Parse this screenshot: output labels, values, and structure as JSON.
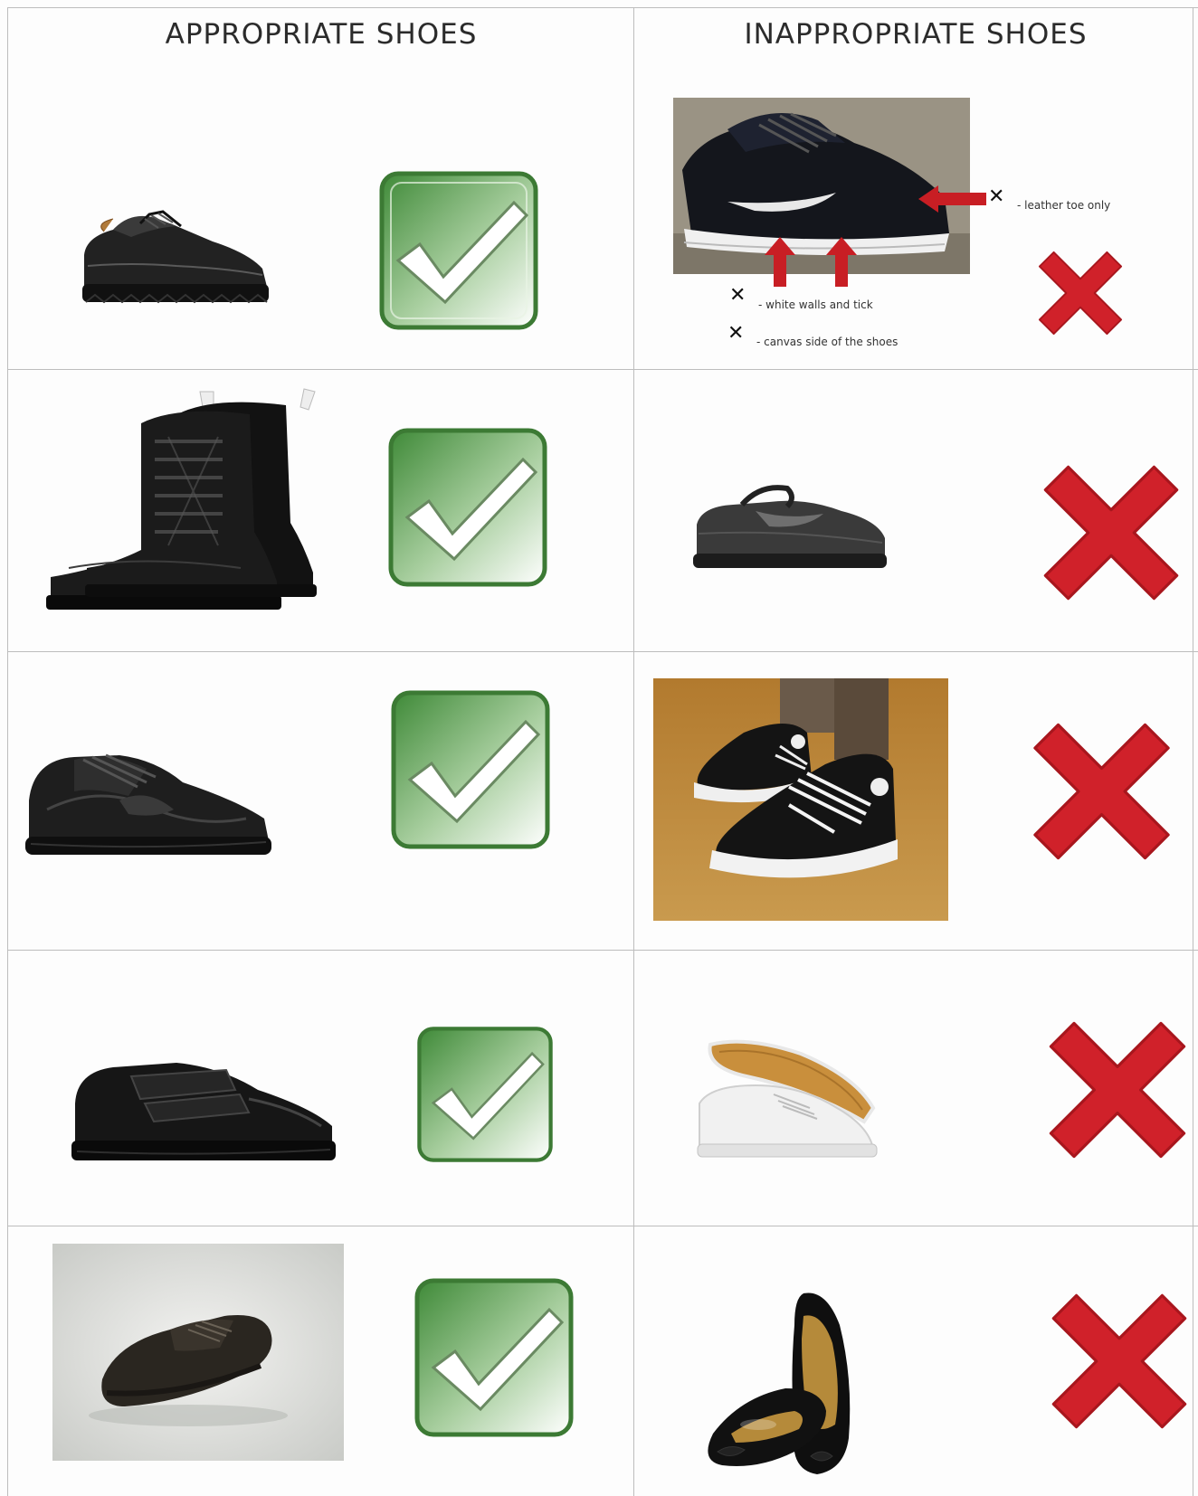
{
  "headers": {
    "appropriate": "APPROPRIATE SHOES",
    "inappropriate": "INAPPROPRIATE SHOES"
  },
  "annotations": {
    "leather_toe": "- leather toe only",
    "white_walls": "- white walls and tick",
    "canvas_side": "- canvas side of the shoes",
    "mark": "✕"
  },
  "appropriate_items": [
    "black-lace-up-school-shoe",
    "black-leather-boots",
    "black-leather-trainer",
    "black-velcro-school-shoe",
    "black-suede-lace-up-shoe"
  ],
  "inappropriate_items": [
    "black-canvas-sneaker-with-white-tick",
    "black-mary-jane-shoe",
    "black-canvas-high-top-sneakers",
    "white-canvas-plimsolls",
    "black-patent-ballet-flats"
  ],
  "colors": {
    "tick_green": "#5a9a4a",
    "cross_red": "#d0212a",
    "arrow_red": "#c81e24",
    "grid": "#bdbdbd"
  }
}
